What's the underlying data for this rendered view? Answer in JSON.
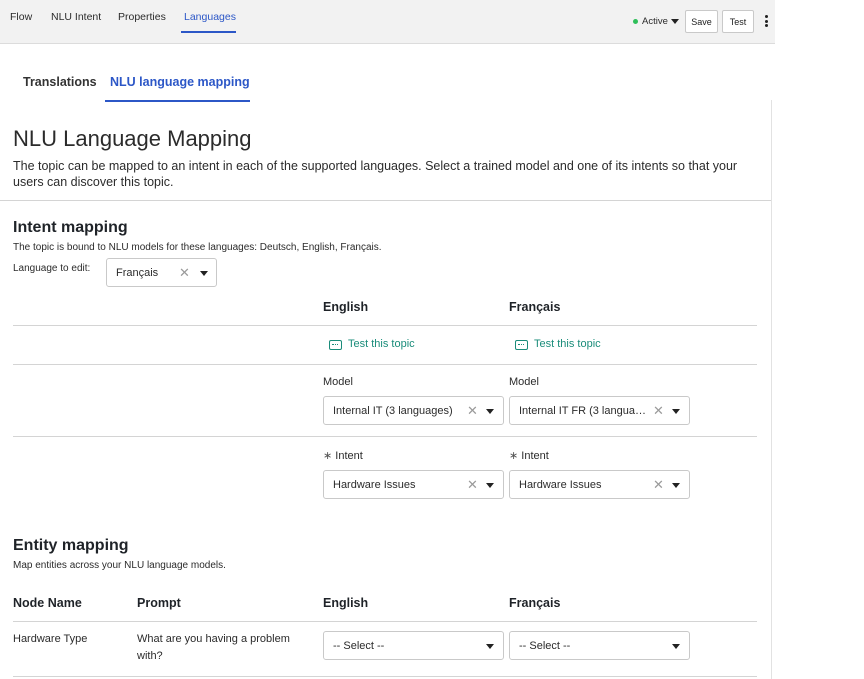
{
  "top_nav": {
    "tabs": [
      "Flow",
      "NLU Intent",
      "Properties",
      "Languages"
    ],
    "active_tab": "Languages",
    "status": "Active",
    "save_label": "Save",
    "test_label": "Test",
    "status_color": "#2fbf5a",
    "accent_color": "#2c57c7"
  },
  "sub_tabs": {
    "items": [
      "Translations",
      "NLU language mapping"
    ],
    "active": "NLU language mapping"
  },
  "page": {
    "title": "NLU Language Mapping",
    "description": "The topic can be mapped to an intent in each of the supported languages. Select a trained model and one of its intents so that your users can discover this topic."
  },
  "intent_mapping": {
    "title": "Intent mapping",
    "bound_text": "The topic is bound to NLU models for these languages: Deutsch, English, Français.",
    "language_label": "Language to edit:",
    "language_value": "Français",
    "columns": [
      "English",
      "Français"
    ],
    "test_link": "Test this topic",
    "model_label": "Model",
    "model_values": [
      "Internal IT (3 languages)",
      "Internal IT FR (3 langua…"
    ],
    "intent_required": "∗",
    "intent_label": "Intent",
    "intent_values": [
      "Hardware Issues",
      "Hardware Issues"
    ]
  },
  "entity_mapping": {
    "title": "Entity mapping",
    "subtitle": "Map entities across your NLU language models.",
    "headers": [
      "Node Name",
      "Prompt",
      "English",
      "Français"
    ],
    "rows": [
      {
        "node": "Hardware Type",
        "prompt_line1": "What are you having a problem",
        "prompt_line2": "with?",
        "english": "-- Select --",
        "french": "-- Select --"
      }
    ]
  }
}
